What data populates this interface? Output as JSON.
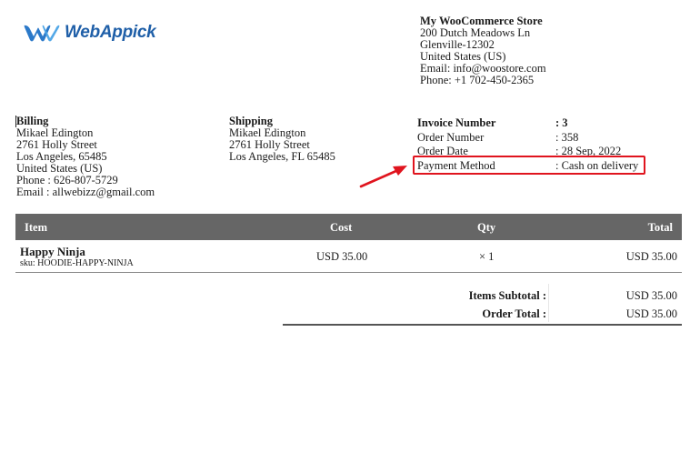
{
  "brand": {
    "name": "WebAppick",
    "color": "#1f5fa8"
  },
  "store": {
    "name": "My WooCommerce Store",
    "address1": "200 Dutch Meadows Ln",
    "address2": "Glenville-12302",
    "country": "United States (US)",
    "email": "Email: info@woostore.com",
    "phone": "Phone: +1 702-450-2365"
  },
  "billing": {
    "title": "Billing",
    "name": "Mikael Edington",
    "street": "2761 Holly Street",
    "city": "Los Angeles, 65485",
    "country": "United States (US)",
    "phone": "Phone : 626-807-5729",
    "email": "Email : allwebizz@gmail.com"
  },
  "shipping": {
    "title": "Shipping",
    "name": "Mikael Edington",
    "street": "2761 Holly Street",
    "city": "Los Angeles, FL 65485"
  },
  "invoice_meta": [
    {
      "label": "Invoice Number",
      "value": ": 3"
    },
    {
      "label": "Order Number",
      "value": ": 358"
    },
    {
      "label": "Order Date",
      "value": ": 28 Sep, 2022"
    },
    {
      "label": "Payment Method",
      "value": ": Cash on delivery"
    }
  ],
  "highlight_color": "#e0141e",
  "table": {
    "headers": {
      "item": "Item",
      "cost": "Cost",
      "qty": "Qty",
      "total": "Total"
    },
    "header_bg": "#666666",
    "rows": [
      {
        "name": "Happy Ninja",
        "sku": "sku: HOODIE-HAPPY-NINJA",
        "cost": "USD 35.00",
        "qty": "× 1",
        "total": "USD 35.00"
      }
    ]
  },
  "totals": {
    "subtotal_label": "Items Subtotal :",
    "subtotal_value": "USD 35.00",
    "order_total_label": "Order Total :",
    "order_total_value": "USD 35.00"
  }
}
